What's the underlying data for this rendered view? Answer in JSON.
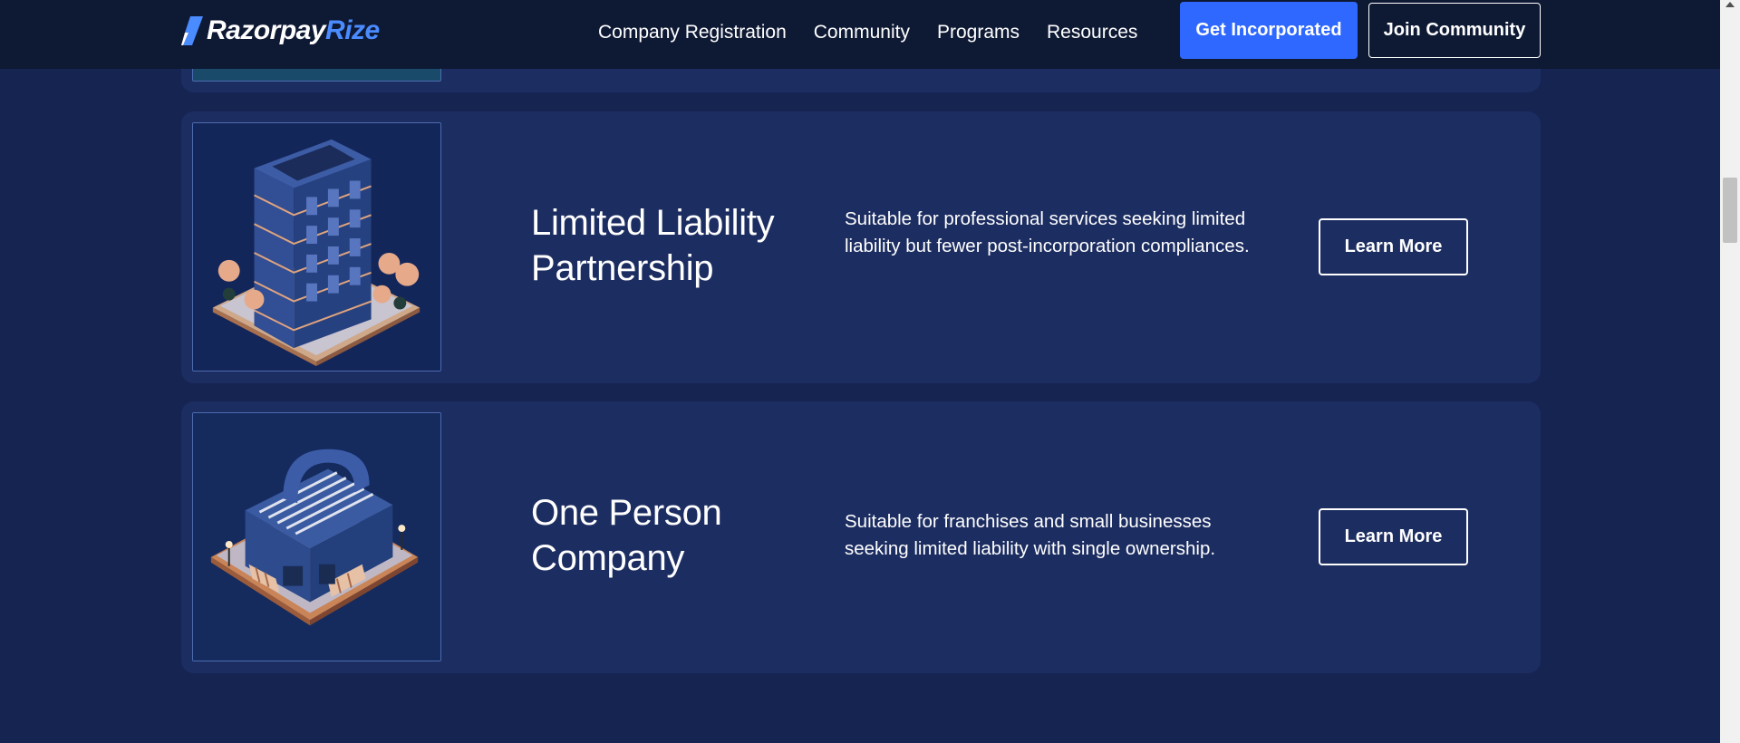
{
  "header": {
    "logo": {
      "part1": "Razorpay",
      "part2": "Rize"
    },
    "nav": [
      {
        "label": "Company Registration"
      },
      {
        "label": "Community"
      },
      {
        "label": "Programs"
      },
      {
        "label": "Resources"
      }
    ],
    "primary_cta": "Get Incorporated",
    "secondary_cta": "Join Community"
  },
  "cards": [
    {
      "title": "Limited Liability Partnership",
      "description": "Suitable for professional services seeking limited liability but fewer post-incorporation compliances.",
      "button": "Learn More",
      "image_icon": "office-building-illustration"
    },
    {
      "title": "One Person Company",
      "description": "Suitable for franchises and small businesses seeking limited liability with single ownership.",
      "button": "Learn More",
      "image_icon": "shop-storefront-illustration"
    }
  ],
  "colors": {
    "page_bg": "#162452",
    "header_bg": "#0e1934",
    "card_bg": "#1c2d61",
    "accent": "#2f68ff",
    "logo_accent": "#4a8bff"
  }
}
